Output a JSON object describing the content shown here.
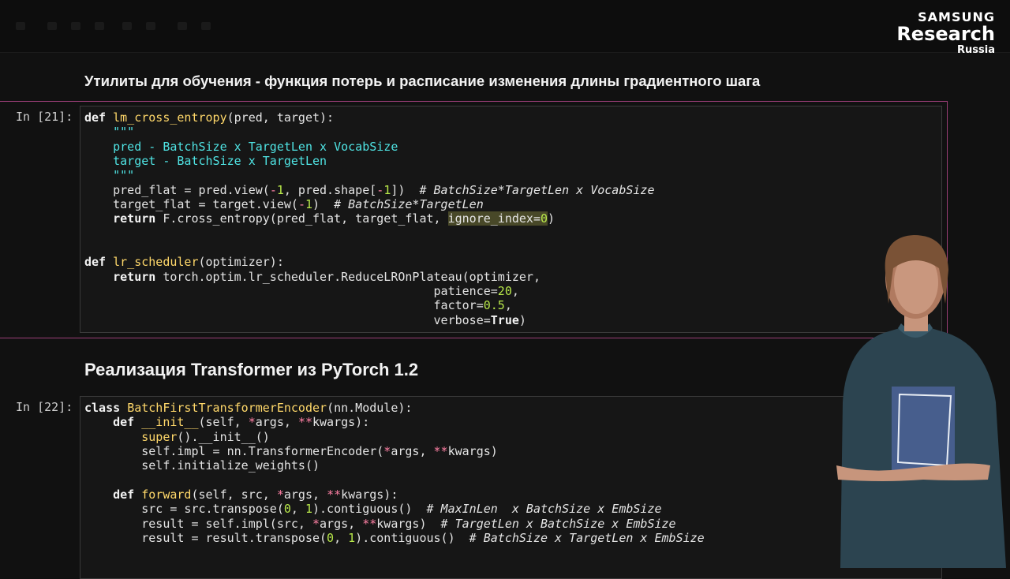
{
  "logo": {
    "line1": "SAMSUNG",
    "line2": "Research",
    "line3": "Russia"
  },
  "headings": {
    "utilities": "Утилиты для обучения - функция потерь и расписание изменения длины градиентного шага",
    "transformer": "Реализация Transformer из PyTorch 1.2"
  },
  "cells": [
    {
      "prompt": "In [21]:",
      "lines": [
        [
          {
            "t": "def",
            "c": "kw"
          },
          {
            "t": " "
          },
          {
            "t": "lm_cross_entropy",
            "c": "fn"
          },
          {
            "t": "(pred, target):"
          }
        ],
        [
          {
            "t": "    "
          },
          {
            "t": "\"\"\"",
            "c": "doc"
          }
        ],
        [
          {
            "t": "    "
          },
          {
            "t": "pred - BatchSize x TargetLen x VocabSize",
            "c": "doc"
          }
        ],
        [
          {
            "t": "    "
          },
          {
            "t": "target - BatchSize x TargetLen",
            "c": "doc"
          }
        ],
        [
          {
            "t": "    "
          },
          {
            "t": "\"\"\"",
            "c": "doc"
          }
        ],
        [
          {
            "t": "    pred_flat = pred.view("
          },
          {
            "t": "-",
            "c": "op"
          },
          {
            "t": "1",
            "c": "num"
          },
          {
            "t": ", pred.shape["
          },
          {
            "t": "-",
            "c": "op"
          },
          {
            "t": "1",
            "c": "num"
          },
          {
            "t": "])  "
          },
          {
            "t": "# BatchSize*TargetLen x VocabSize",
            "c": "cm"
          }
        ],
        [
          {
            "t": "    target_flat = target.view("
          },
          {
            "t": "-",
            "c": "op"
          },
          {
            "t": "1",
            "c": "num"
          },
          {
            "t": ")  "
          },
          {
            "t": "# BatchSize*TargetLen",
            "c": "cm"
          }
        ],
        [
          {
            "t": "    "
          },
          {
            "t": "return",
            "c": "kw"
          },
          {
            "t": " F.cross_entropy(pred_flat, target_flat, "
          },
          {
            "t": "ignore_index=",
            "c": "sel"
          },
          {
            "t": "0",
            "c": "num sel"
          },
          {
            "t": ")"
          }
        ],
        [],
        [],
        [
          {
            "t": "def",
            "c": "kw"
          },
          {
            "t": " "
          },
          {
            "t": "lr_scheduler",
            "c": "fn"
          },
          {
            "t": "(optimizer):"
          }
        ],
        [
          {
            "t": "    "
          },
          {
            "t": "return",
            "c": "kw"
          },
          {
            "t": " torch.optim.lr_scheduler.ReduceLROnPlateau(optimizer,"
          }
        ],
        [
          {
            "t": "                                                 patience="
          },
          {
            "t": "20",
            "c": "num"
          },
          {
            "t": ","
          }
        ],
        [
          {
            "t": "                                                 factor="
          },
          {
            "t": "0.5",
            "c": "num"
          },
          {
            "t": ","
          }
        ],
        [
          {
            "t": "                                                 verbose="
          },
          {
            "t": "True",
            "c": "kw"
          },
          {
            "t": ")"
          }
        ]
      ]
    },
    {
      "prompt": "In [22]:",
      "lines": [
        [
          {
            "t": "class",
            "c": "kw"
          },
          {
            "t": " "
          },
          {
            "t": "BatchFirstTransformerEncoder",
            "c": "fn"
          },
          {
            "t": "(nn.Module):"
          }
        ],
        [
          {
            "t": "    "
          },
          {
            "t": "def",
            "c": "kw"
          },
          {
            "t": " "
          },
          {
            "t": "__init__",
            "c": "fn"
          },
          {
            "t": "(self, "
          },
          {
            "t": "*",
            "c": "op"
          },
          {
            "t": "args, "
          },
          {
            "t": "**",
            "c": "op"
          },
          {
            "t": "kwargs):"
          }
        ],
        [
          {
            "t": "        "
          },
          {
            "t": "super",
            "c": "fn"
          },
          {
            "t": "().__init__()"
          }
        ],
        [
          {
            "t": "        self.impl = nn.TransformerEncoder("
          },
          {
            "t": "*",
            "c": "op"
          },
          {
            "t": "args, "
          },
          {
            "t": "**",
            "c": "op"
          },
          {
            "t": "kwargs)"
          }
        ],
        [
          {
            "t": "        self.initialize_weights()"
          }
        ],
        [],
        [
          {
            "t": "    "
          },
          {
            "t": "def",
            "c": "kw"
          },
          {
            "t": " "
          },
          {
            "t": "forward",
            "c": "fn"
          },
          {
            "t": "(self, src, "
          },
          {
            "t": "*",
            "c": "op"
          },
          {
            "t": "args, "
          },
          {
            "t": "**",
            "c": "op"
          },
          {
            "t": "kwargs):"
          }
        ],
        [
          {
            "t": "        src = src.transpose("
          },
          {
            "t": "0",
            "c": "num"
          },
          {
            "t": ", "
          },
          {
            "t": "1",
            "c": "num"
          },
          {
            "t": ").contiguous()  "
          },
          {
            "t": "# MaxInLen  x BatchSize x EmbSize",
            "c": "cm"
          }
        ],
        [
          {
            "t": "        result = self.impl(src, "
          },
          {
            "t": "*",
            "c": "op"
          },
          {
            "t": "args, "
          },
          {
            "t": "**",
            "c": "op"
          },
          {
            "t": "kwargs)  "
          },
          {
            "t": "# TargetLen x BatchSize x EmbSize",
            "c": "cm"
          }
        ],
        [
          {
            "t": "        result = result.transpose("
          },
          {
            "t": "0",
            "c": "num"
          },
          {
            "t": ", "
          },
          {
            "t": "1",
            "c": "num"
          },
          {
            "t": ").contiguous()  "
          },
          {
            "t": "# BatchSize x TargetLen x EmbSize",
            "c": "cm"
          }
        ]
      ]
    }
  ],
  "colors": {
    "background": "#111111",
    "cell_border": "#9a3e76",
    "keyword": "#f3f3f3",
    "function_name": "#ffd86a",
    "docstring": "#4fe3e3",
    "number": "#b8e84a",
    "operator": "#ff80a5"
  }
}
